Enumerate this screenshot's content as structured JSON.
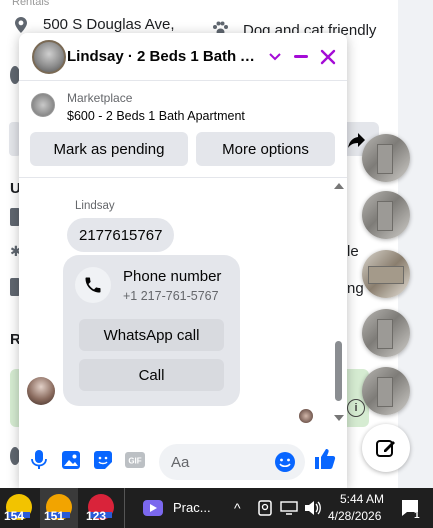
{
  "background": {
    "rentals_label": "Rentals",
    "address": "500 S Douglas Ave,",
    "pets": "Dog and cat friendly",
    "letter_u": "U",
    "letter_r": "R",
    "partial_le": "le",
    "partial_ng": "ng"
  },
  "chat": {
    "title": "Lindsay · 2 Beds 1 Bath Ap...",
    "marketplace_label": "Marketplace",
    "listing": "$600 - 2 Beds 1 Bath Apartment",
    "mark_pending": "Mark as pending",
    "more_options": "More options",
    "sender": "Lindsay",
    "message": "2177615767",
    "phone_title": "Phone number",
    "phone_number": "+1 217-761-5767",
    "whatsapp_call": "WhatsApp call",
    "call": "Call",
    "input_placeholder": "Aa",
    "accent_color": "#a40bd6",
    "brand_blue": "#0866ff"
  },
  "taskbar": {
    "app1_badge": "154",
    "app2_badge": "151",
    "app3_badge": "123",
    "active_app_label": "Prac...",
    "time": "5:44 AM",
    "date": "4/28/2026",
    "notification_count": "1"
  }
}
